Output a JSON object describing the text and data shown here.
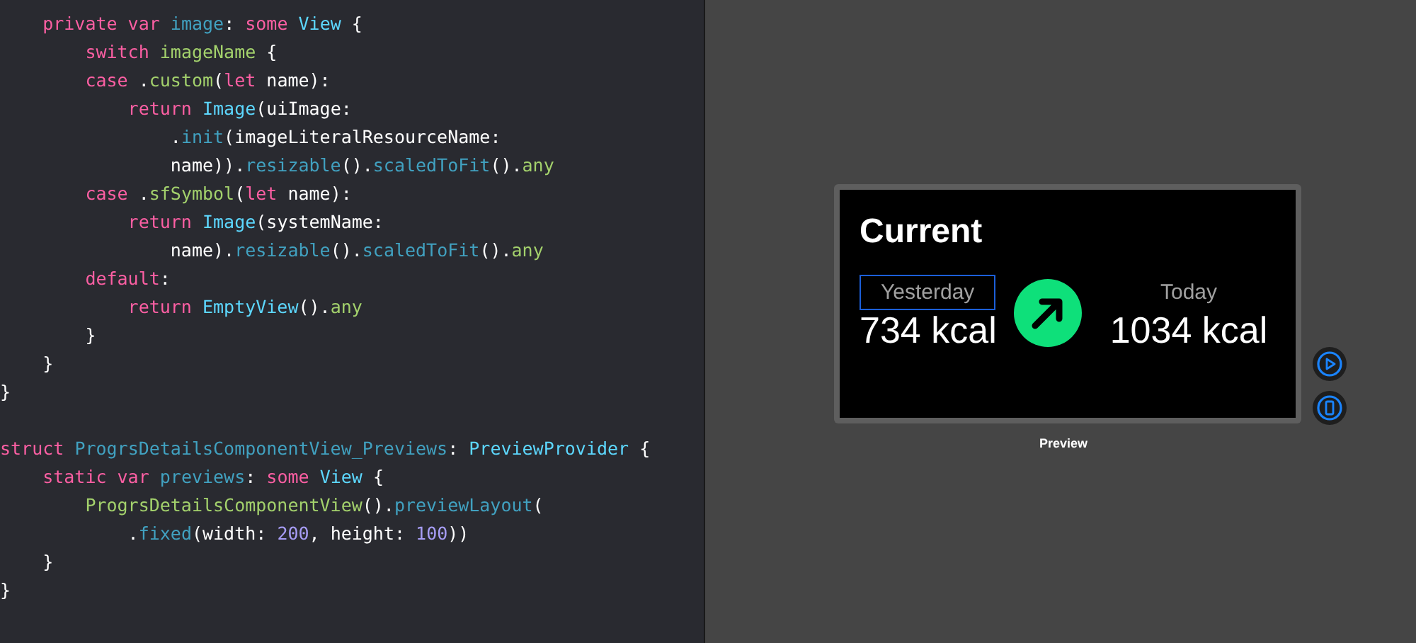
{
  "editor": {
    "blocks": [
      {
        "lines": [
          {
            "tokens": [
              {
                "text": "    private var ",
                "kind": "keyword"
              },
              {
                "text": "image",
                "kind": "decl"
              },
              {
                "text": ": ",
                "kind": "plain"
              },
              {
                "text": "some ",
                "kind": "keyword"
              },
              {
                "text": "View",
                "kind": "type"
              },
              {
                "text": " {",
                "kind": "plain"
              }
            ]
          },
          {
            "tokens": [
              {
                "text": "        switch ",
                "kind": "keyword"
              },
              {
                "text": "imageName",
                "kind": "ident"
              },
              {
                "text": " {",
                "kind": "plain"
              }
            ]
          },
          {
            "tokens": [
              {
                "text": "        case ",
                "kind": "keyword"
              },
              {
                "text": ".",
                "kind": "plain"
              },
              {
                "text": "custom",
                "kind": "ident"
              },
              {
                "text": "(",
                "kind": "plain"
              },
              {
                "text": "let ",
                "kind": "keyword"
              },
              {
                "text": "name):",
                "kind": "plain"
              }
            ]
          },
          {
            "tokens": [
              {
                "text": "            return ",
                "kind": "keyword"
              },
              {
                "text": "Image",
                "kind": "type"
              },
              {
                "text": "(uiImage:",
                "kind": "plain"
              }
            ]
          },
          {
            "tokens": [
              {
                "text": "                .",
                "kind": "plain"
              },
              {
                "text": "init",
                "kind": "method"
              },
              {
                "text": "(imageLiteralResourceName:",
                "kind": "plain"
              }
            ]
          },
          {
            "tokens": [
              {
                "text": "                name)).",
                "kind": "plain"
              },
              {
                "text": "resizable",
                "kind": "method"
              },
              {
                "text": "().",
                "kind": "plain"
              },
              {
                "text": "scaledToFit",
                "kind": "method"
              },
              {
                "text": "().",
                "kind": "plain"
              },
              {
                "text": "any",
                "kind": "ident"
              }
            ]
          },
          {
            "tokens": [
              {
                "text": "        case ",
                "kind": "keyword"
              },
              {
                "text": ".",
                "kind": "plain"
              },
              {
                "text": "sfSymbol",
                "kind": "ident"
              },
              {
                "text": "(",
                "kind": "plain"
              },
              {
                "text": "let ",
                "kind": "keyword"
              },
              {
                "text": "name):",
                "kind": "plain"
              }
            ]
          },
          {
            "tokens": [
              {
                "text": "            return ",
                "kind": "keyword"
              },
              {
                "text": "Image",
                "kind": "type"
              },
              {
                "text": "(systemName:",
                "kind": "plain"
              }
            ]
          },
          {
            "tokens": [
              {
                "text": "                name).",
                "kind": "plain"
              },
              {
                "text": "resizable",
                "kind": "method"
              },
              {
                "text": "().",
                "kind": "plain"
              },
              {
                "text": "scaledToFit",
                "kind": "method"
              },
              {
                "text": "().",
                "kind": "plain"
              },
              {
                "text": "any",
                "kind": "ident"
              }
            ]
          },
          {
            "tokens": [
              {
                "text": "        default",
                "kind": "keyword"
              },
              {
                "text": ":",
                "kind": "plain"
              }
            ]
          },
          {
            "tokens": [
              {
                "text": "            return ",
                "kind": "keyword"
              },
              {
                "text": "EmptyView",
                "kind": "type"
              },
              {
                "text": "().",
                "kind": "plain"
              },
              {
                "text": "any",
                "kind": "ident"
              }
            ]
          },
          {
            "tokens": [
              {
                "text": "        }",
                "kind": "plain"
              }
            ]
          },
          {
            "tokens": [
              {
                "text": "    }",
                "kind": "plain"
              }
            ]
          },
          {
            "tokens": [
              {
                "text": "}",
                "kind": "plain"
              }
            ]
          }
        ]
      },
      {
        "lines": [
          {
            "tokens": [
              {
                "text": "struct ",
                "kind": "keyword"
              },
              {
                "text": "ProgrsDetailsComponentView_Previews",
                "kind": "decl"
              },
              {
                "text": ": ",
                "kind": "plain"
              },
              {
                "text": "PreviewProvider",
                "kind": "type"
              },
              {
                "text": " {",
                "kind": "plain"
              }
            ]
          },
          {
            "tokens": [
              {
                "text": "    static var ",
                "kind": "keyword"
              },
              {
                "text": "previews",
                "kind": "decl"
              },
              {
                "text": ": ",
                "kind": "plain"
              },
              {
                "text": "some ",
                "kind": "keyword"
              },
              {
                "text": "View",
                "kind": "type"
              },
              {
                "text": " {",
                "kind": "plain"
              }
            ]
          },
          {
            "tokens": [
              {
                "text": "        ProgrsDetailsComponentView",
                "kind": "ident"
              },
              {
                "text": "().",
                "kind": "plain"
              },
              {
                "text": "previewLayout",
                "kind": "method"
              },
              {
                "text": "(",
                "kind": "plain"
              }
            ]
          },
          {
            "tokens": [
              {
                "text": "            .",
                "kind": "plain"
              },
              {
                "text": "fixed",
                "kind": "method"
              },
              {
                "text": "(width: ",
                "kind": "plain"
              },
              {
                "text": "200",
                "kind": "number"
              },
              {
                "text": ", height: ",
                "kind": "plain"
              },
              {
                "text": "100",
                "kind": "number"
              },
              {
                "text": "))",
                "kind": "plain"
              }
            ]
          },
          {
            "tokens": [
              {
                "text": "    }",
                "kind": "plain"
              }
            ]
          },
          {
            "tokens": [
              {
                "text": "}",
                "kind": "plain"
              }
            ]
          }
        ]
      }
    ]
  },
  "preview": {
    "title": "Current",
    "stats": [
      {
        "label": "Yesterday",
        "value": "734 kcal",
        "selected": true
      },
      {
        "label": "Today",
        "value": "1034 kcal",
        "selected": false
      }
    ],
    "caption": "Preview"
  }
}
